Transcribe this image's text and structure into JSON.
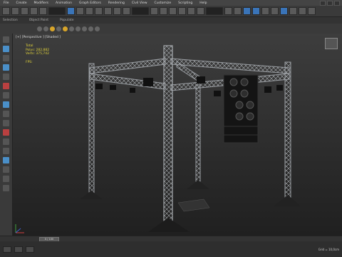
{
  "menu": {
    "items": [
      "File",
      "Create",
      "Modifiers",
      "Animation",
      "Graph Editors",
      "Rendering",
      "Civil View",
      "Customize",
      "Scripting",
      "Help"
    ]
  },
  "ribbon": {
    "tabs": [
      "Selection",
      "Object Paint",
      "Populate"
    ]
  },
  "viewport": {
    "label": "[+] [Perspective ] [Shaded ]",
    "stats": {
      "title": "Total",
      "polys": "Polys: 282,882",
      "verts": "Verts: 375,742",
      "fps": "FPS:"
    }
  },
  "timeline": {
    "frame": "0 / 100"
  },
  "status": {
    "grid": "Grid = 10,0cm"
  },
  "colors": {
    "accent": "#3a74b8",
    "stats_text": "#e0d23a",
    "truss": "#9a9ea3"
  }
}
